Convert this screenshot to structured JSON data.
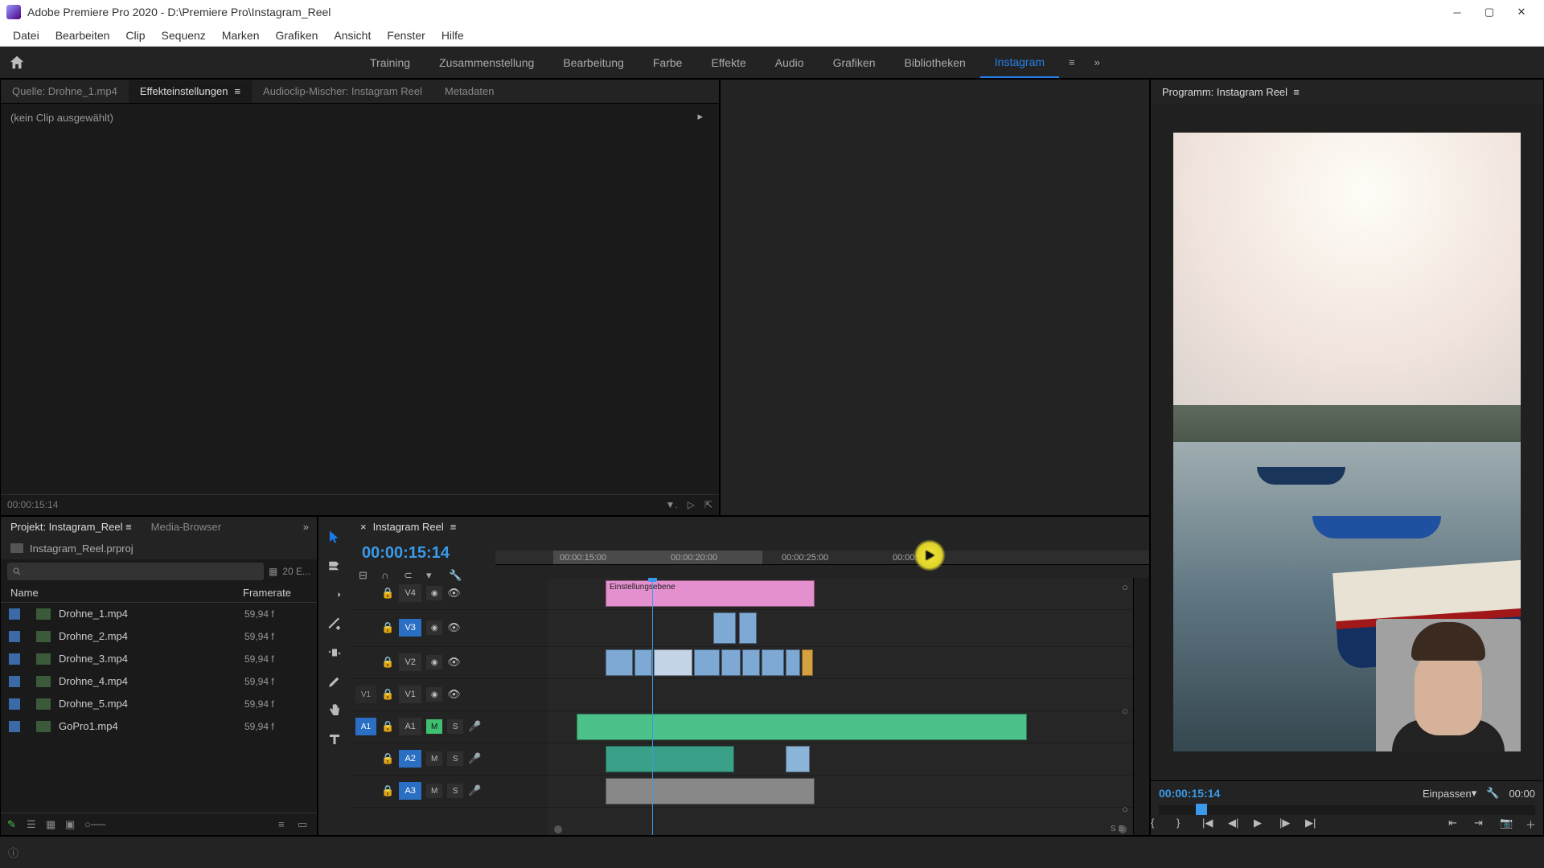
{
  "titlebar": {
    "title": "Adobe Premiere Pro 2020 - D:\\Premiere Pro\\Instagram_Reel"
  },
  "menu": {
    "items": [
      "Datei",
      "Bearbeiten",
      "Clip",
      "Sequenz",
      "Marken",
      "Grafiken",
      "Ansicht",
      "Fenster",
      "Hilfe"
    ]
  },
  "workspaces": {
    "items": [
      "Training",
      "Zusammenstellung",
      "Bearbeitung",
      "Farbe",
      "Effekte",
      "Audio",
      "Grafiken",
      "Bibliotheken",
      "Instagram"
    ],
    "active": "Instagram"
  },
  "source": {
    "tabs": [
      "Quelle: Drohne_1.mp4",
      "Effekteinstellungen",
      "Audioclip-Mischer: Instagram Reel",
      "Metadaten"
    ],
    "active": "Effekteinstellungen",
    "no_clip": "(kein Clip ausgewählt)",
    "timecode": "00:00:15:14"
  },
  "program": {
    "title": "Programm: Instagram Reel",
    "timecode": "00:00:15:14",
    "zoom": "Einpassen",
    "duration": "00:00",
    "ss_label": "S S"
  },
  "project": {
    "tabs": [
      "Projekt: Instagram_Reel",
      "Media-Browser"
    ],
    "active": "Projekt: Instagram_Reel",
    "file": "Instagram_Reel.prproj",
    "item_count": "20 E...",
    "columns": {
      "name": "Name",
      "framerate": "Framerate"
    },
    "items": [
      {
        "name": "Drohne_1.mp4",
        "fps": "59,94 f"
      },
      {
        "name": "Drohne_2.mp4",
        "fps": "59,94 f"
      },
      {
        "name": "Drohne_3.mp4",
        "fps": "59,94 f"
      },
      {
        "name": "Drohne_4.mp4",
        "fps": "59,94 f"
      },
      {
        "name": "Drohne_5.mp4",
        "fps": "59,94 f"
      },
      {
        "name": "GoPro1.mp4",
        "fps": "59,94 f"
      }
    ]
  },
  "timeline": {
    "sequence_name": "Instagram Reel",
    "timecode": "00:00:15:14",
    "ruler": [
      "00:00:15:00",
      "00:00:20:00",
      "00:00:25:00",
      "00:00:30:00"
    ],
    "tracks": {
      "v4": "V4",
      "v3": "V3",
      "v2": "V2",
      "v1": "V1",
      "a1": "A1",
      "a2": "A2",
      "a3": "A3"
    },
    "clip_adjustment": "Einstellungsebene",
    "btn_m": "M",
    "btn_s": "S"
  }
}
